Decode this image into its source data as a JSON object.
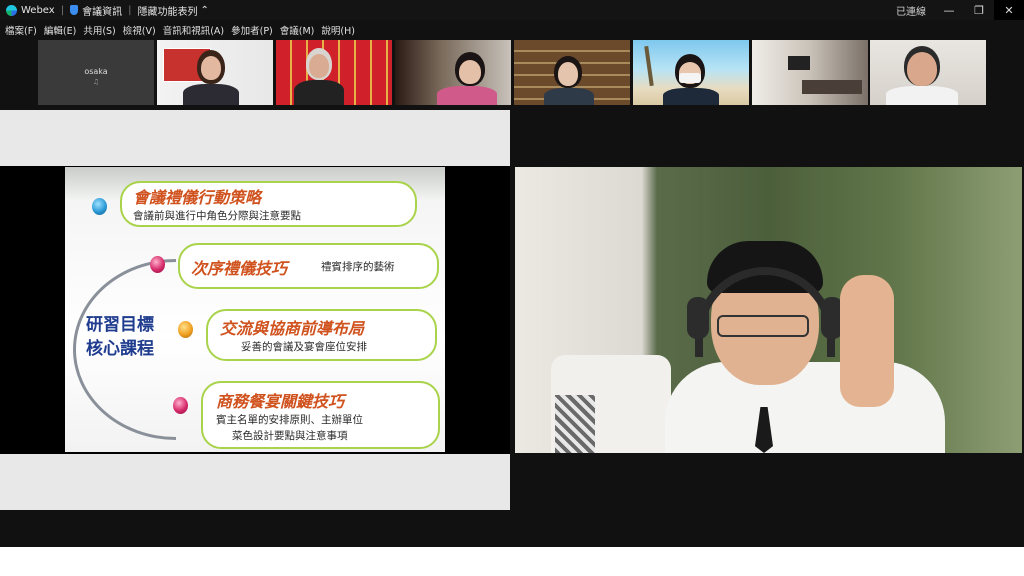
{
  "titlebar": {
    "app": "Webex",
    "meeting_info": "會議資訊",
    "hidden_toolbar": "隱藏功能表列",
    "status": "已連線"
  },
  "menubar": [
    "檔案(F)",
    "編輯(E)",
    "共用(S)",
    "檢視(V)",
    "音訊和視訊(A)",
    "參加者(P)",
    "會議(M)",
    "說明(H)"
  ],
  "participants": [
    {
      "name": "osaka",
      "icon": "mic-muted-icon"
    }
  ],
  "slide": {
    "core_line1": "研習目標",
    "core_line2": "核心課程",
    "items": [
      {
        "title": "會議禮儀行動策略",
        "sub": "會議前與進行中角色分際與注意要點",
        "color": "#2a9ad6"
      },
      {
        "title": "次序禮儀技巧",
        "sub": "禮賓排序的藝術",
        "color": "#d62a6a"
      },
      {
        "title": "交流與協商前導布局",
        "sub": "妥善的會議及宴會座位安排",
        "color": "#f0a020"
      },
      {
        "title": "商務餐宴關鍵技巧",
        "sub": "賓主名單的安排原則、主辦單位",
        "sub2": "菜色設計要點與注意事項",
        "color": "#d62a6a"
      }
    ]
  },
  "colors": {
    "accent_green": "#a9d34a",
    "title_orange": "#d0521e",
    "core_blue": "#1f3c8f"
  }
}
